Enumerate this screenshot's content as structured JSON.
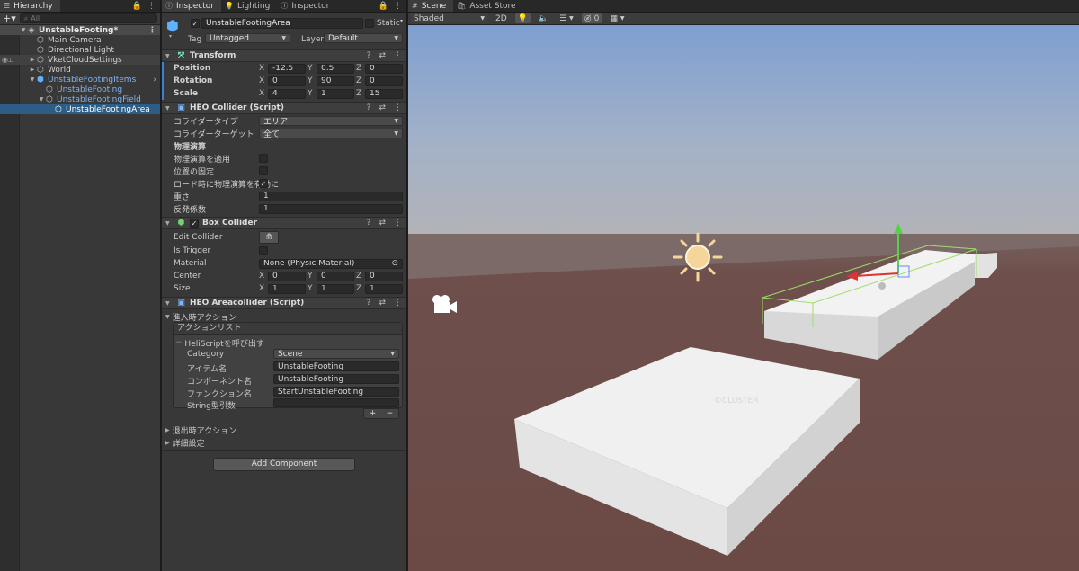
{
  "hierarchy": {
    "tab_label": "Hierarchy",
    "search_placeholder": "All",
    "items": [
      {
        "label": "UnstableFooting*"
      },
      {
        "label": "Main Camera"
      },
      {
        "label": "Directional Light"
      },
      {
        "label": "VketCloudSettings"
      },
      {
        "label": "World"
      },
      {
        "label": "UnstableFootingItems"
      },
      {
        "label": "UnstableFooting"
      },
      {
        "label": "UnstableFootingField"
      },
      {
        "label": "UnstableFootingArea"
      }
    ]
  },
  "inspector": {
    "tabs": [
      "Inspector",
      "Lighting",
      "Inspector"
    ],
    "object_name": "UnstableFootingArea",
    "static_label": "Static",
    "tag_label": "Tag",
    "tag_value": "Untagged",
    "layer_label": "Layer",
    "layer_value": "Default",
    "transform": {
      "title": "Transform",
      "position_label": "Position",
      "rotation_label": "Rotation",
      "scale_label": "Scale",
      "axis_x": "X",
      "axis_y": "Y",
      "axis_z": "Z",
      "position": [
        "-12.5",
        "0.5",
        "0"
      ],
      "rotation": [
        "0",
        "90",
        "0"
      ],
      "scale": [
        "4",
        "1",
        "15"
      ]
    },
    "heo_collider": {
      "title": "HEO Collider (Script)",
      "collider_type_label": "コライダータイプ",
      "collider_type_value": "エリア",
      "collider_target_label": "コライダーターゲット",
      "collider_target_value": "全て",
      "physics_header": "物理演算",
      "apply_physics_label": "物理演算を適用",
      "fix_position_label": "位置の固定",
      "enable_on_load_label": "ロード時に物理演算を有効に",
      "weight_label": "重さ",
      "weight_value": "1",
      "restitution_label": "反発係数",
      "restitution_value": "1"
    },
    "box_collider": {
      "title": "Box Collider",
      "edit_collider_label": "Edit Collider",
      "is_trigger_label": "Is Trigger",
      "material_label": "Material",
      "material_value": "None (Physic Material)",
      "center_label": "Center",
      "center": [
        "0",
        "0",
        "0"
      ],
      "size_label": "Size",
      "size": [
        "1",
        "1",
        "1"
      ]
    },
    "heo_areacollider": {
      "title": "HEO Areacollider (Script)",
      "enter_action_label": "進入時アクション",
      "action_list_label": "アクションリスト",
      "action_item_label": "HeliScriptを呼び出す",
      "category_label": "Category",
      "category_value": "Scene",
      "item_name_label": "アイテム名",
      "item_name_value": "UnstableFooting",
      "component_name_label": "コンポーネント名",
      "component_name_value": "UnstableFooting",
      "function_name_label": "ファンクション名",
      "function_name_value": "StartUnstableFooting",
      "string_arg_label": "String型引数",
      "string_arg_value": "",
      "add_symbol": "+",
      "remove_symbol": "−",
      "exit_action_label": "退出時アクション",
      "details_label": "詳細設定"
    },
    "add_component_label": "Add Component"
  },
  "scene": {
    "tabs": [
      "Scene",
      "Asset Store"
    ],
    "shading_mode": "Shaded",
    "toggle_2d": "2D",
    "gizmo_count": "0",
    "watermark": "©CLUSTER"
  },
  "colors": {
    "sky_top": "#7f9fd0",
    "sky_horizon": "#b3b3b8",
    "ground": "#6b4a46",
    "selection": "#2c5d87",
    "prefab_text": "#7fb3f0",
    "sun": "#f5d59a"
  }
}
